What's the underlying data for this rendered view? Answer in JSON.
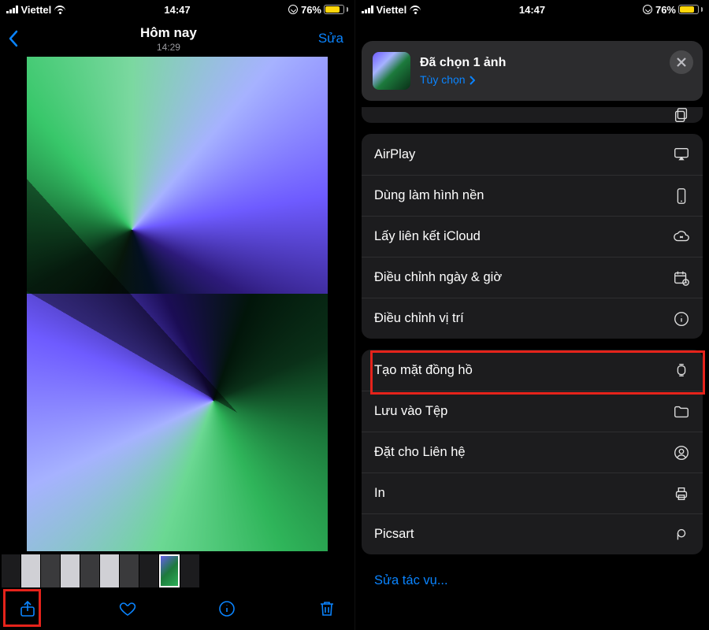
{
  "status": {
    "carrier": "Viettel",
    "time": "14:47",
    "battery_pct": "76%"
  },
  "left": {
    "title": "Hôm nay",
    "subtitle": "14:29",
    "edit": "Sửa"
  },
  "sheet": {
    "header_title": "Đã chọn 1 ảnh",
    "header_options": "Tùy chọn",
    "group1": [
      {
        "label": "AirPlay",
        "icon": "airplay"
      },
      {
        "label": "Dùng làm hình nền",
        "icon": "phone"
      },
      {
        "label": "Lấy liên kết iCloud",
        "icon": "cloud-link"
      },
      {
        "label": "Điều chỉnh ngày & giờ",
        "icon": "calendar-clock"
      },
      {
        "label": "Điều chỉnh vị trí",
        "icon": "info"
      }
    ],
    "group2": [
      {
        "label": "Tạo mặt đồng hồ",
        "icon": "watch"
      },
      {
        "label": "Lưu vào Tệp",
        "icon": "folder"
      },
      {
        "label": "Đặt cho Liên hệ",
        "icon": "person"
      },
      {
        "label": "In",
        "icon": "printer"
      },
      {
        "label": "Picsart",
        "icon": "picsart"
      }
    ],
    "edit_actions": "Sửa tác vụ..."
  }
}
